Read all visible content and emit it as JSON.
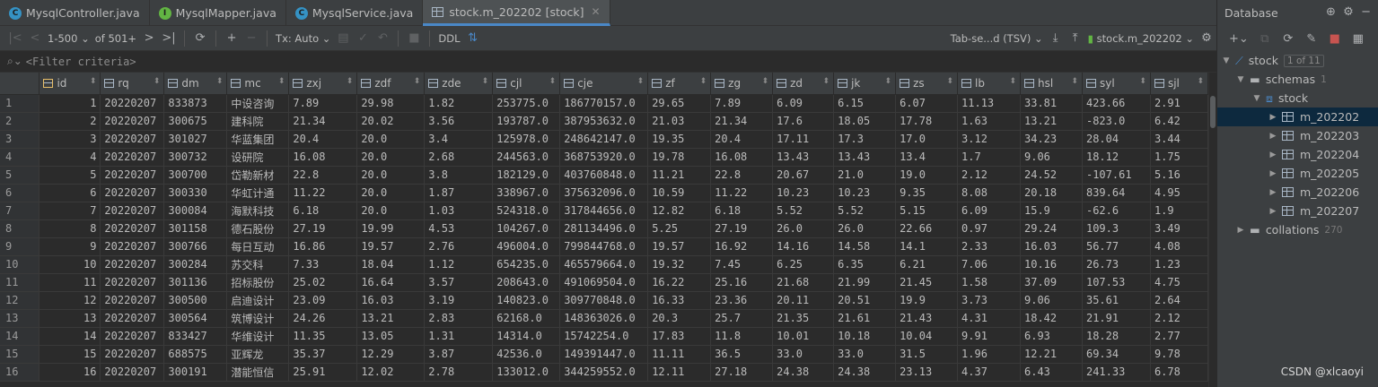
{
  "tabs": [
    {
      "label": "MysqlController.java",
      "icon": "C",
      "color": "#3592c4"
    },
    {
      "label": "MysqlMapper.java",
      "icon": "I",
      "color": "#62b543"
    },
    {
      "label": "MysqlService.java",
      "icon": "C",
      "color": "#3592c4"
    },
    {
      "label": "stock.m_202202 [stock]",
      "icon": "table-icon",
      "active": true
    }
  ],
  "toolbar": {
    "page_range": "1-500",
    "page_total": "of 501+",
    "tx_mode": "Tx: Auto",
    "ddl": "DDL",
    "export_format": "Tab-se...d (TSV)",
    "target_table": "stock.m_202202"
  },
  "filter": {
    "placeholder": "<Filter criteria>"
  },
  "columns": [
    "id",
    "rq",
    "dm",
    "mc",
    "zxj",
    "zdf",
    "zde",
    "cjl",
    "cje",
    "zf",
    "zg",
    "zd",
    "jk",
    "zs",
    "lb",
    "hsl",
    "syl",
    "sjl"
  ],
  "rows": [
    [
      "1",
      "20220207",
      "833873",
      "中设咨询",
      "7.89",
      "29.98",
      "1.82",
      "253775.0",
      "186770157.0",
      "29.65",
      "7.89",
      "6.09",
      "6.15",
      "6.07",
      "11.13",
      "33.81",
      "423.66",
      "2.91"
    ],
    [
      "2",
      "20220207",
      "300675",
      "建科院",
      "21.34",
      "20.02",
      "3.56",
      "193787.0",
      "387953632.0",
      "21.03",
      "21.34",
      "17.6",
      "18.05",
      "17.78",
      "1.63",
      "13.21",
      "-823.0",
      "6.42"
    ],
    [
      "3",
      "20220207",
      "301027",
      "华蓝集团",
      "20.4",
      "20.0",
      "3.4",
      "125978.0",
      "248642147.0",
      "19.35",
      "20.4",
      "17.11",
      "17.3",
      "17.0",
      "3.12",
      "34.23",
      "28.04",
      "3.44"
    ],
    [
      "4",
      "20220207",
      "300732",
      "设研院",
      "16.08",
      "20.0",
      "2.68",
      "244563.0",
      "368753920.0",
      "19.78",
      "16.08",
      "13.43",
      "13.43",
      "13.4",
      "1.7",
      "9.06",
      "18.12",
      "1.75"
    ],
    [
      "5",
      "20220207",
      "300700",
      "岱勒新材",
      "22.8",
      "20.0",
      "3.8",
      "182129.0",
      "403760848.0",
      "11.21",
      "22.8",
      "20.67",
      "21.0",
      "19.0",
      "2.12",
      "24.52",
      "-107.61",
      "5.16"
    ],
    [
      "6",
      "20220207",
      "300330",
      "华虹计通",
      "11.22",
      "20.0",
      "1.87",
      "338967.0",
      "375632096.0",
      "10.59",
      "11.22",
      "10.23",
      "10.23",
      "9.35",
      "8.08",
      "20.18",
      "839.64",
      "4.95"
    ],
    [
      "7",
      "20220207",
      "300084",
      "海默科技",
      "6.18",
      "20.0",
      "1.03",
      "524318.0",
      "317844656.0",
      "12.82",
      "6.18",
      "5.52",
      "5.52",
      "5.15",
      "6.09",
      "15.9",
      "-62.6",
      "1.9"
    ],
    [
      "8",
      "20220207",
      "301158",
      "德石股份",
      "27.19",
      "19.99",
      "4.53",
      "104267.0",
      "281134496.0",
      "5.25",
      "27.19",
      "26.0",
      "26.0",
      "22.66",
      "0.97",
      "29.24",
      "109.3",
      "3.49"
    ],
    [
      "9",
      "20220207",
      "300766",
      "每日互动",
      "16.86",
      "19.57",
      "2.76",
      "496004.0",
      "799844768.0",
      "19.57",
      "16.92",
      "14.16",
      "14.58",
      "14.1",
      "2.33",
      "16.03",
      "56.77",
      "4.08"
    ],
    [
      "10",
      "20220207",
      "300284",
      "苏交科",
      "7.33",
      "18.04",
      "1.12",
      "654235.0",
      "465579664.0",
      "19.32",
      "7.45",
      "6.25",
      "6.35",
      "6.21",
      "7.06",
      "10.16",
      "26.73",
      "1.23"
    ],
    [
      "11",
      "20220207",
      "301136",
      "招标股份",
      "25.02",
      "16.64",
      "3.57",
      "208643.0",
      "491069504.0",
      "16.22",
      "25.16",
      "21.68",
      "21.99",
      "21.45",
      "1.58",
      "37.09",
      "107.53",
      "4.75"
    ],
    [
      "12",
      "20220207",
      "300500",
      "启迪设计",
      "23.09",
      "16.03",
      "3.19",
      "140823.0",
      "309770848.0",
      "16.33",
      "23.36",
      "20.11",
      "20.51",
      "19.9",
      "3.73",
      "9.06",
      "35.61",
      "2.64"
    ],
    [
      "13",
      "20220207",
      "300564",
      "筑博设计",
      "24.26",
      "13.21",
      "2.83",
      "62168.0",
      "148363026.0",
      "20.3",
      "25.7",
      "21.35",
      "21.61",
      "21.43",
      "4.31",
      "18.42",
      "21.91",
      "2.12"
    ],
    [
      "14",
      "20220207",
      "833427",
      "华维设计",
      "11.35",
      "13.05",
      "1.31",
      "14314.0",
      "15742254.0",
      "17.83",
      "11.8",
      "10.01",
      "10.18",
      "10.04",
      "9.91",
      "6.93",
      "18.28",
      "2.77"
    ],
    [
      "15",
      "20220207",
      "688575",
      "亚辉龙",
      "35.37",
      "12.29",
      "3.87",
      "42536.0",
      "149391447.0",
      "11.11",
      "36.5",
      "33.0",
      "33.0",
      "31.5",
      "1.96",
      "12.21",
      "69.34",
      "9.78"
    ],
    [
      "16",
      "20220207",
      "300191",
      "潜能恒信",
      "25.91",
      "12.02",
      "2.78",
      "133012.0",
      "344259552.0",
      "12.11",
      "27.18",
      "24.38",
      "24.38",
      "23.13",
      "4.37",
      "6.43",
      "241.33",
      "6.78"
    ]
  ],
  "db_panel": {
    "title": "Database",
    "tree": {
      "root": {
        "label": "stock",
        "badge": "1 of 11"
      },
      "schemas": {
        "label": "schemas",
        "count": "1"
      },
      "schema": {
        "label": "stock"
      },
      "tables": [
        "m_202202",
        "m_202203",
        "m_202204",
        "m_202205",
        "m_202206",
        "m_202207"
      ],
      "collations": {
        "label": "collations",
        "count": "270"
      }
    }
  },
  "watermark": "CSDN @xlcaoyi",
  "colors": {
    "accent": "#4a88c7",
    "selected": "#0d293e",
    "bg": "#2b2b2b",
    "panel": "#3c3f41"
  }
}
